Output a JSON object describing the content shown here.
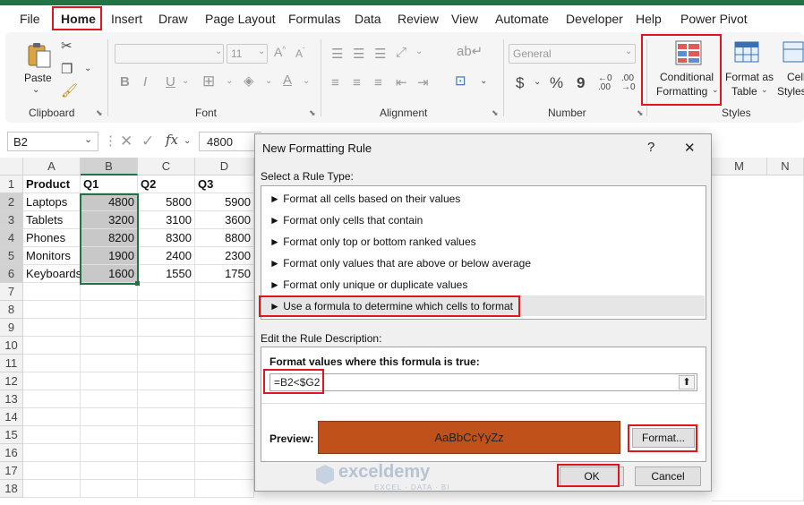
{
  "menu": {
    "items": [
      "File",
      "Home",
      "Insert",
      "Draw",
      "Page Layout",
      "Formulas",
      "Data",
      "Review",
      "View",
      "Automate",
      "Developer",
      "Help",
      "Power Pivot"
    ]
  },
  "ribbon": {
    "paste_label": "Paste",
    "font_name_value": "",
    "font_size_value": "11",
    "number_format_value": "General",
    "conditional_formatting_line1": "Conditional",
    "conditional_formatting_line2": "Formatting",
    "format_as_table_line1": "Format as",
    "format_as_table_line2": "Table",
    "cell_styles_line1": "Cell",
    "cell_styles_line2": "Styles",
    "groups": {
      "clipboard": "Clipboard",
      "font": "Font",
      "alignment": "Alignment",
      "number": "Number",
      "styles": "Styles"
    },
    "bold": "B",
    "italic": "I",
    "underline": "U",
    "currency": "$",
    "percent": "%",
    "comma": "9",
    "fx": "fx"
  },
  "formula_bar": {
    "name_box": "B2",
    "content": "4800"
  },
  "sheet": {
    "columns": [
      "A",
      "B",
      "C",
      "D",
      "M",
      "N"
    ],
    "row_numbers": [
      "1",
      "2",
      "3",
      "4",
      "5",
      "6",
      "7",
      "8",
      "9",
      "10",
      "11",
      "12",
      "13",
      "14",
      "15",
      "16",
      "17",
      "18"
    ],
    "header_row": [
      "Product",
      "Q1",
      "Q2",
      "Q3"
    ],
    "rows": [
      [
        "Laptops",
        "4800",
        "5800",
        "5900"
      ],
      [
        "Tablets",
        "3200",
        "3100",
        "3600"
      ],
      [
        "Phones",
        "8200",
        "8300",
        "8800"
      ],
      [
        "Monitors",
        "1900",
        "2400",
        "2300"
      ],
      [
        "Keyboards",
        "1600",
        "1550",
        "1750"
      ]
    ]
  },
  "dialog": {
    "title": "New Formatting Rule",
    "help": "?",
    "close": "✕",
    "select_rule_label": "Select a Rule Type:",
    "rule_types": [
      "► Format all cells based on their values",
      "► Format only cells that contain",
      "► Format only top or bottom ranked values",
      "► Format only values that are above or below average",
      "► Format only unique or duplicate values",
      "► Use a formula to determine which cells to format"
    ],
    "edit_rule_label": "Edit the Rule Description:",
    "formula_label": "Format values where this formula is true:",
    "formula_value": "=B2<$G2",
    "preview_label": "Preview:",
    "preview_text": "AaBbCcYyZz",
    "preview_color": "#c0511a",
    "format_button": "Format...",
    "ok_button": "OK",
    "cancel_button": "Cancel"
  },
  "watermark": {
    "name": "exceldemy",
    "tagline": "EXCEL · DATA · BI"
  },
  "colors": {
    "excel_green": "#217346",
    "highlight_red": "#e0151f",
    "selection_gray": "#c8c8c8"
  }
}
